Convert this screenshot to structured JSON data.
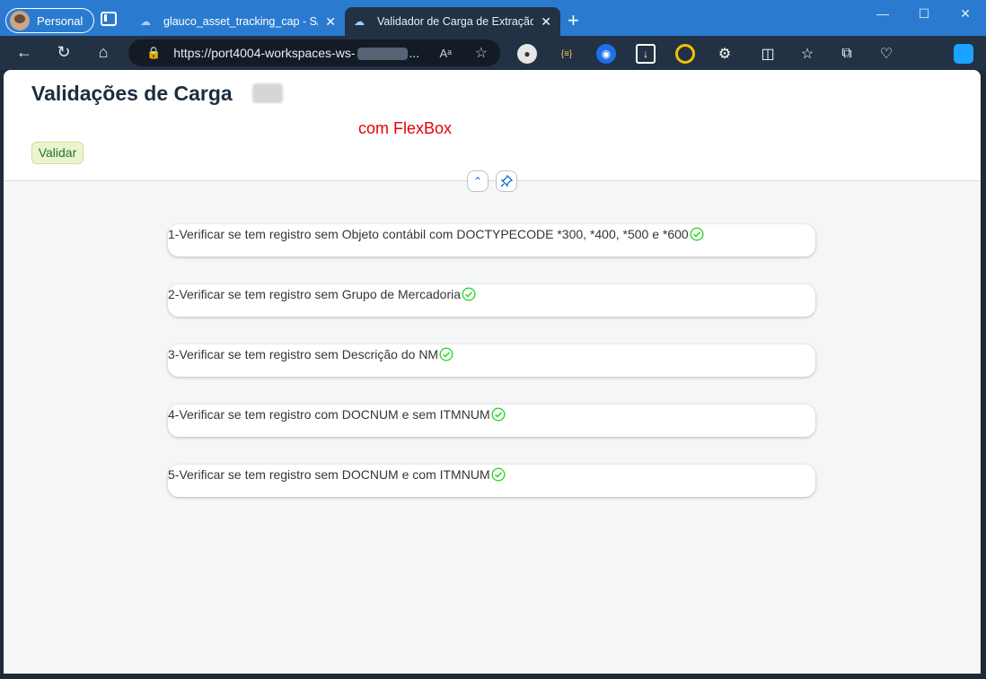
{
  "browser": {
    "profile_label": "Personal",
    "tabs": [
      {
        "label": "glauco_asset_tracking_cap - SAP",
        "active": false
      },
      {
        "label": "Validador de Carga de Extração de",
        "active": true
      }
    ],
    "newtab_symbol": "+",
    "window_controls": [
      "—",
      "☐",
      "✕"
    ],
    "address": {
      "url_prefix": "https://port4004-workspaces-ws-",
      "url_suffix": "...",
      "read_aloud": "Aᵃ"
    },
    "extension_label": "{≡}"
  },
  "header": {
    "title": "Validações de Carga",
    "flexbox_label": "com FlexBox",
    "validate_button": "Validar",
    "collapse_symbol": "⌃",
    "pin_symbol": "📌"
  },
  "checks": [
    {
      "text": "1-Verificar se tem registro sem Objeto contábil com DOCTYPECODE *300, *400, *500 e *600",
      "status": "success"
    },
    {
      "text": "2-Verificar se tem registro sem Grupo de Mercadoria",
      "status": "success"
    },
    {
      "text": "3-Verificar se tem registro sem Descrição do NM",
      "status": "success"
    },
    {
      "text": "4-Verificar se tem registro com DOCNUM e sem ITMNUM",
      "status": "success"
    },
    {
      "text": "5-Verificar se tem registro sem DOCNUM e com ITMNUM",
      "status": "success"
    }
  ],
  "colors": {
    "titlebar": "#2a7bd0",
    "toolbar": "#223244",
    "accent_red": "#e60000",
    "success_green": "#2bd82b"
  }
}
